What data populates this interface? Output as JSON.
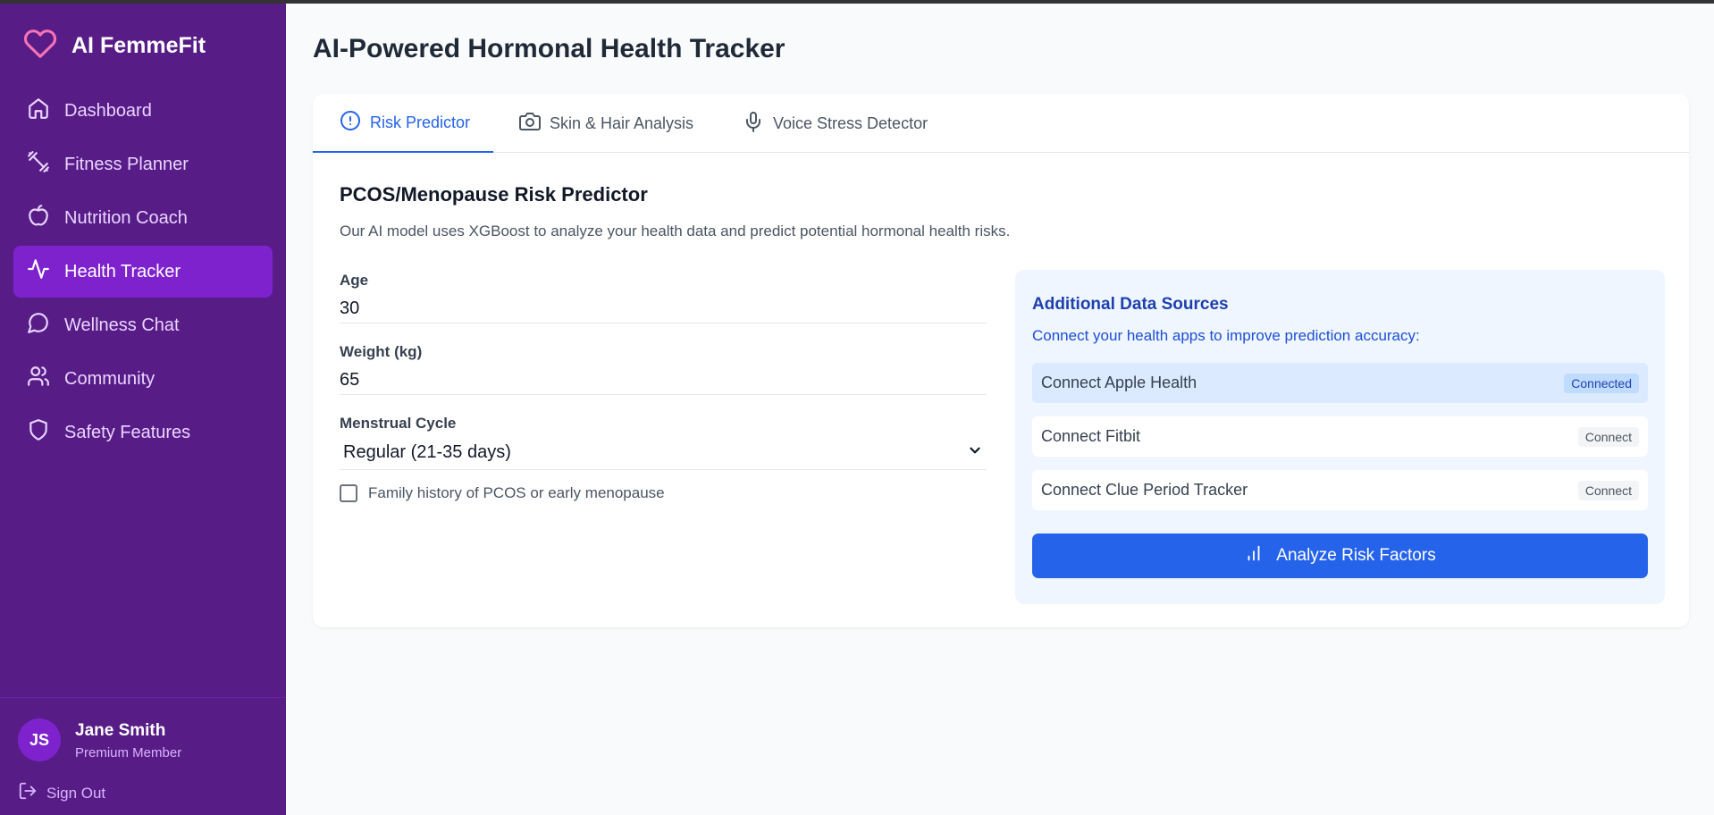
{
  "app": {
    "name": "AI FemmeFit"
  },
  "sidebar": {
    "items": [
      {
        "label": "Dashboard",
        "icon": "home-icon"
      },
      {
        "label": "Fitness Planner",
        "icon": "dumbbell-icon"
      },
      {
        "label": "Nutrition Coach",
        "icon": "apple-icon"
      },
      {
        "label": "Health Tracker",
        "icon": "activity-icon",
        "active": true
      },
      {
        "label": "Wellness Chat",
        "icon": "chat-icon"
      },
      {
        "label": "Community",
        "icon": "users-icon"
      },
      {
        "label": "Safety Features",
        "icon": "shield-icon"
      }
    ],
    "user": {
      "initials": "JS",
      "name": "Jane Smith",
      "role": "Premium Member"
    },
    "signout_label": "Sign Out"
  },
  "main": {
    "title": "AI-Powered Hormonal Health Tracker",
    "tabs": [
      {
        "label": "Risk Predictor",
        "icon": "alert-circle-icon",
        "active": true
      },
      {
        "label": "Skin & Hair Analysis",
        "icon": "camera-icon"
      },
      {
        "label": "Voice Stress Detector",
        "icon": "microphone-icon"
      }
    ],
    "section": {
      "title": "PCOS/Menopause Risk Predictor",
      "description": "Our AI model uses XGBoost to analyze your health data and predict potential hormonal health risks."
    },
    "form": {
      "age_label": "Age",
      "age_value": "30",
      "weight_label": "Weight (kg)",
      "weight_value": "65",
      "cycle_label": "Menstrual Cycle",
      "cycle_value": "Regular (21-35 days)",
      "family_history_label": "Family history of PCOS or early menopause",
      "family_history_checked": false
    },
    "sources": {
      "title": "Additional Data Sources",
      "description": "Connect your health apps to improve prediction accuracy:",
      "items": [
        {
          "label": "Connect Apple Health",
          "status": "Connected",
          "connected": true
        },
        {
          "label": "Connect Fitbit",
          "status": "Connect",
          "connected": false
        },
        {
          "label": "Connect Clue Period Tracker",
          "status": "Connect",
          "connected": false
        }
      ],
      "analyze_label": "Analyze Risk Factors"
    }
  },
  "colors": {
    "sidebar_bg": "#581c87",
    "sidebar_active": "#7e22ce",
    "accent": "#2563eb",
    "brand_heart": "#f472b6"
  }
}
